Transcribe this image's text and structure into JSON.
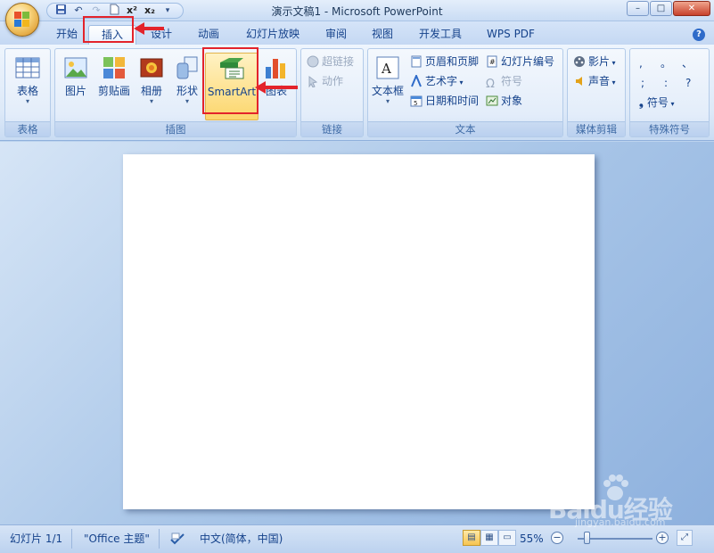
{
  "window": {
    "title": "演示文稿1 - Microsoft PowerPoint",
    "minimize": "–",
    "maximize": "□",
    "close": "✕"
  },
  "qat": {
    "items": [
      "save-icon",
      "undo-icon",
      "redo-icon",
      "open-icon",
      "superscript-icon",
      "subscript-icon",
      "qat-dropdown-icon"
    ],
    "superscript_label": "x²",
    "subscript_label": "x₂"
  },
  "tabs": [
    {
      "label": "开始",
      "active": false
    },
    {
      "label": "插入",
      "active": true
    },
    {
      "label": "设计",
      "active": false
    },
    {
      "label": "动画",
      "active": false
    },
    {
      "label": "幻灯片放映",
      "active": false
    },
    {
      "label": "审阅",
      "active": false
    },
    {
      "label": "视图",
      "active": false
    },
    {
      "label": "开发工具",
      "active": false
    },
    {
      "label": "WPS PDF",
      "active": false
    }
  ],
  "help": "?",
  "ribbon": {
    "groups": {
      "table": {
        "label": "表格",
        "button": "表格"
      },
      "illustrations": {
        "label": "插图",
        "picture": "图片",
        "clipart": "剪贴画",
        "album": "相册",
        "shapes": "形状",
        "smartart": "SmartArt",
        "chart": "图表"
      },
      "links": {
        "label": "链接",
        "hyperlink": "超链接",
        "action": "动作"
      },
      "text": {
        "label": "文本",
        "textbox": "文本框",
        "header_footer": "页眉和页脚",
        "wordart": "艺术字",
        "datetime": "日期和时间",
        "slide_number": "幻灯片编号",
        "symbol": "符号",
        "object": "对象"
      },
      "media": {
        "label": "媒体剪辑",
        "movie": "影片",
        "sound": "声音"
      },
      "special": {
        "label": "特殊符号",
        "symbols": [
          ",",
          "。",
          "、",
          ";",
          ":",
          "?"
        ],
        "symbol_button": "符号"
      }
    }
  },
  "status": {
    "slide": "幻灯片 1/1",
    "theme": "\"Office 主题\"",
    "language": "中文(简体，中国)",
    "zoom": "55%"
  },
  "watermark": {
    "text": "Baidu经验",
    "url": "jingyan.baidu.com"
  },
  "colors": {
    "highlight": "#e3232b",
    "ribbon_bg": "#dde9f8",
    "accent": "#15428b"
  }
}
